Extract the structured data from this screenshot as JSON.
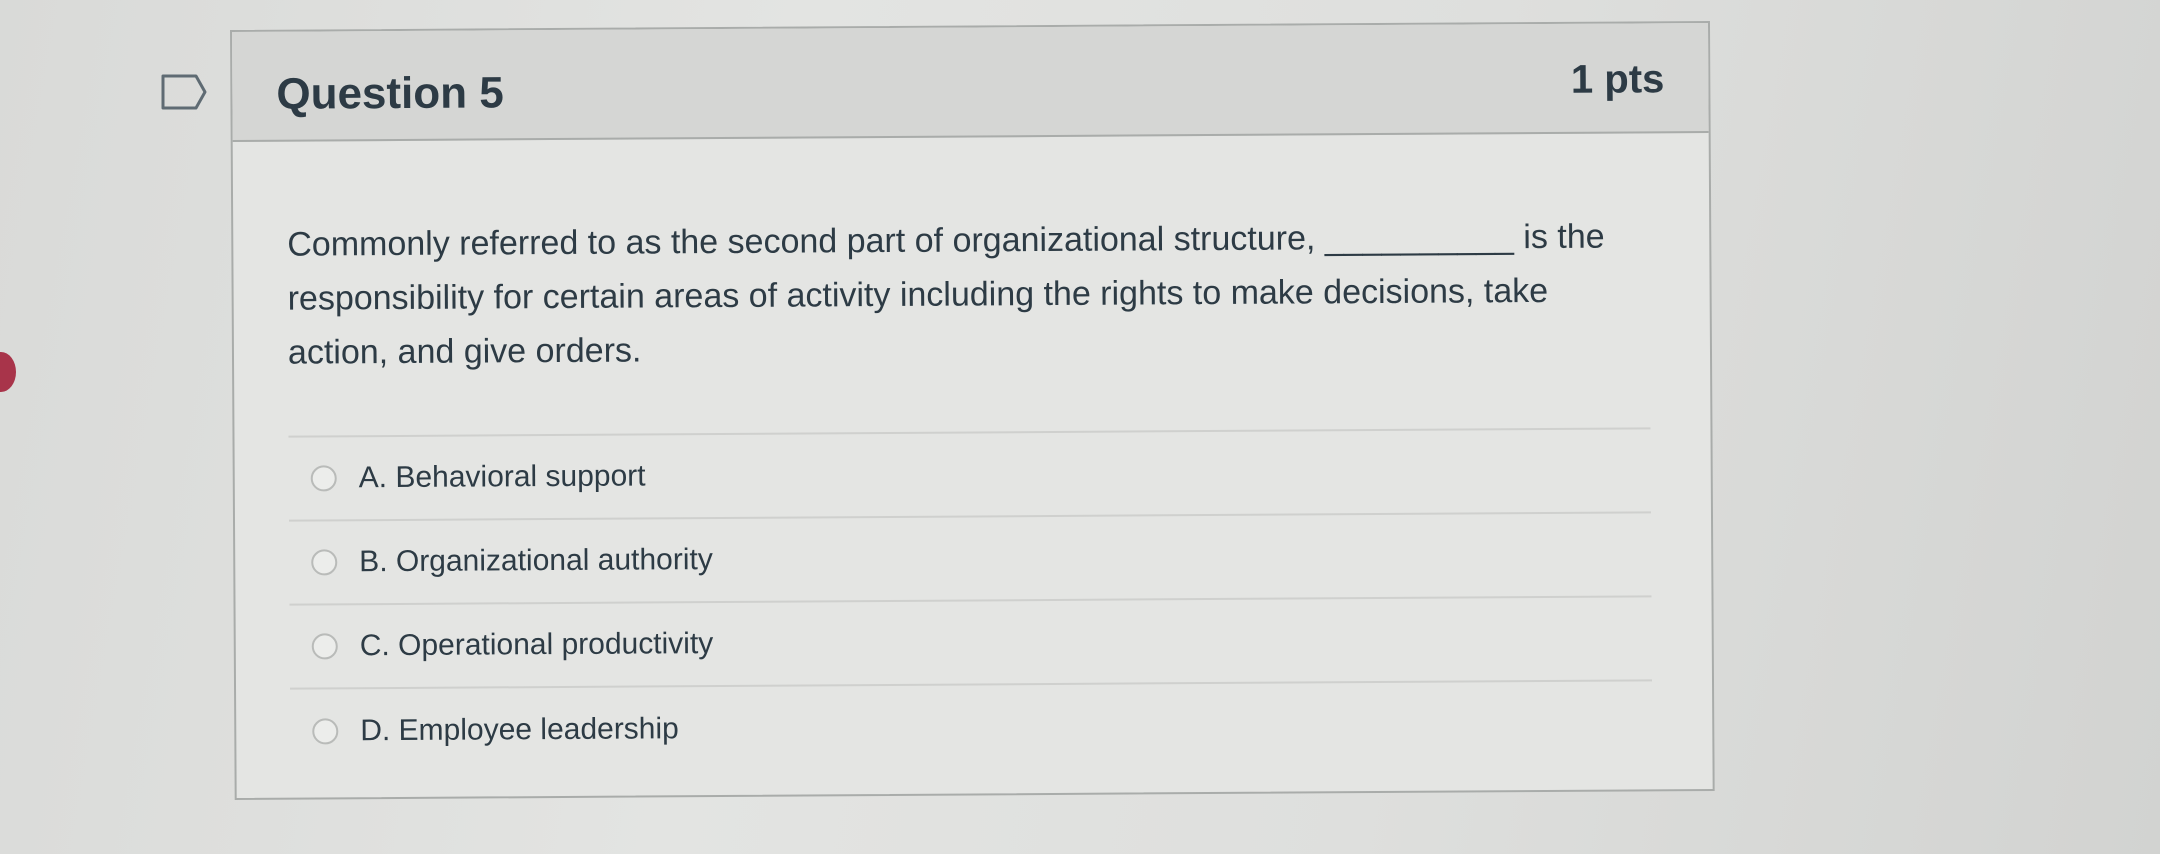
{
  "question": {
    "title": "Question 5",
    "points": "1 pts",
    "text": "Commonly referred to as the second part of organizational structure, __________ is the responsibility for certain areas of activity including the rights to make decisions, take action, and give orders.",
    "answers": [
      {
        "label": "A. Behavioral support"
      },
      {
        "label": "B. Organizational authority"
      },
      {
        "label": "C. Operational productivity"
      },
      {
        "label": "D. Employee leadership"
      }
    ]
  },
  "icons": {
    "flag": "flag-outline-icon",
    "radio": "radio-unchecked"
  },
  "colors": {
    "text": "#2d3b45",
    "border": "#a9acaa",
    "header_bg": "#d5d6d4",
    "left_accent": "#a8344a"
  }
}
